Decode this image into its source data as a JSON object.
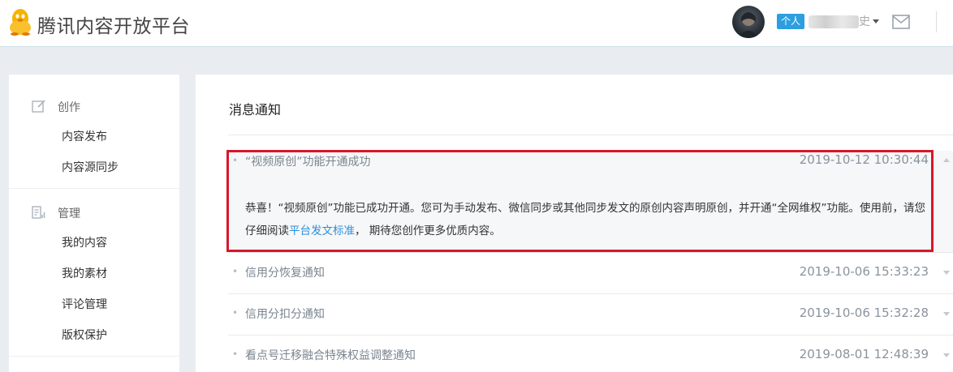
{
  "header": {
    "brand": "腾讯内容开放平台",
    "account_tag": "个人",
    "username_visible": "史",
    "logo_icon": "penguin-icon",
    "mail_icon": "mail-icon"
  },
  "sidebar": {
    "sections": [
      {
        "icon": "edit-icon",
        "title": "创作",
        "items": [
          "内容发布",
          "内容源同步"
        ]
      },
      {
        "icon": "manage-icon",
        "title": "管理",
        "items": [
          "我的内容",
          "我的素材",
          "评论管理",
          "版权保护"
        ]
      }
    ]
  },
  "main": {
    "title": "消息通知",
    "notices": [
      {
        "title": "“视频原创”功能开通成功",
        "time": "2019-10-12 10:30:44",
        "expanded": true,
        "body_before_link": "恭喜！“视频原创”功能已成功开通。您可为手动发布、微信同步或其他同步发文的原创内容声明原创，并开通“全网维权”功能。使用前，请您仔细阅读",
        "body_link": "平台发文标准",
        "body_after_link": "，  期待您创作更多优质内容。"
      },
      {
        "title": "信用分恢复通知",
        "time": "2019-10-06 15:33:23",
        "expanded": false
      },
      {
        "title": "信用分扣分通知",
        "time": "2019-10-06 15:32:28",
        "expanded": false
      },
      {
        "title": "看点号迁移融合特殊权益调整通知",
        "time": "2019-08-01 12:48:39",
        "expanded": false
      }
    ]
  },
  "colors": {
    "accent": "#2d9ee0",
    "link": "#2d8fdc",
    "highlight_border": "#d8172a",
    "page_bg": "#e9edf1"
  }
}
